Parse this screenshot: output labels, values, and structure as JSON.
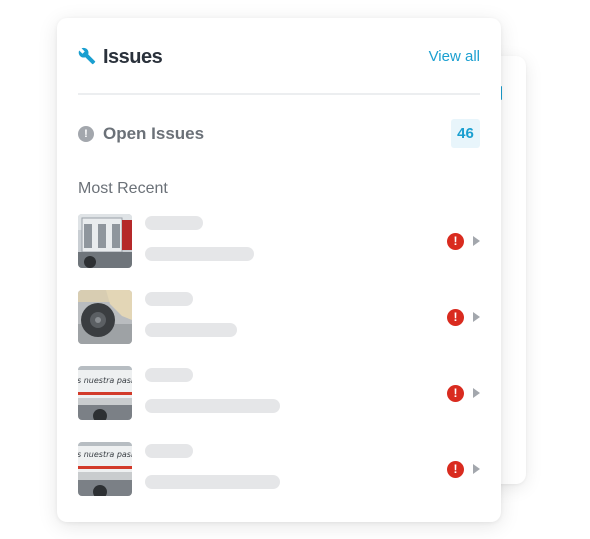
{
  "widget": {
    "title": "Issues",
    "title_icon": "wrench-icon",
    "view_all_label": "View all",
    "open_issues": {
      "label": "Open Issues",
      "icon": "alert-icon",
      "count": "46"
    },
    "section_label": "Most Recent",
    "items": [
      {
        "thumbnail": "truck-rear-photo",
        "status_icon": "alert-icon",
        "status_glyph": "!"
      },
      {
        "thumbnail": "truck-wheel-photo",
        "status_icon": "alert-icon",
        "status_glyph": "!"
      },
      {
        "thumbnail": "truck-side-photo",
        "thumbnail_text": "s nuestra pasió",
        "status_icon": "alert-icon",
        "status_glyph": "!"
      },
      {
        "thumbnail": "truck-side-photo",
        "thumbnail_text": "s nuestra pasió",
        "status_icon": "alert-icon",
        "status_glyph": "!"
      }
    ]
  },
  "colors": {
    "accent": "#1a9fd0",
    "alert": "#d92b1f",
    "title_text": "#2a313b",
    "muted_text": "#6b7178",
    "skeleton": "#e5e6e8",
    "badge_bg": "#e8f5fb"
  }
}
